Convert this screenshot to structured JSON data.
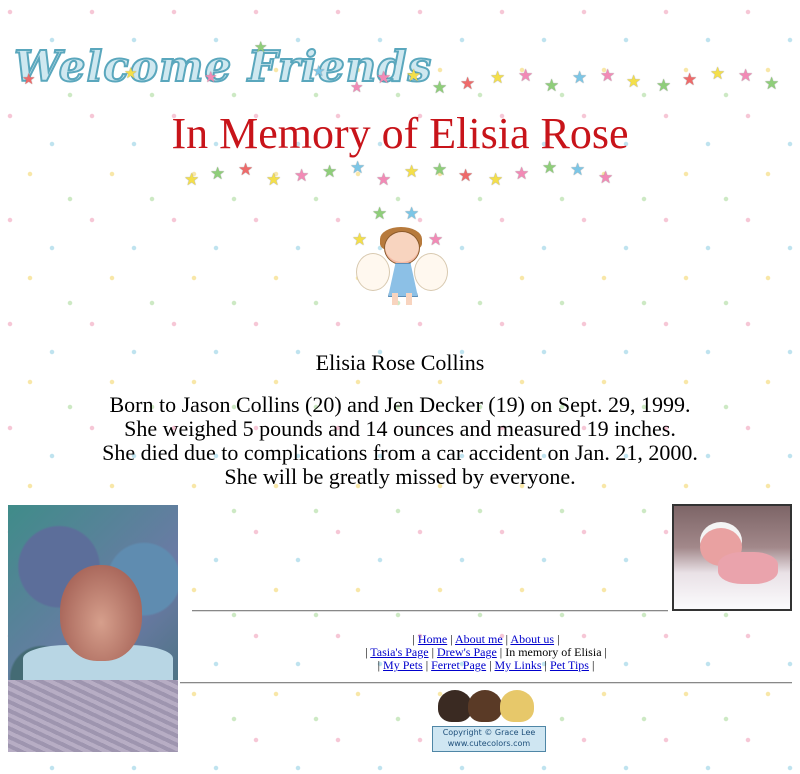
{
  "header": {
    "welcome_text": "Welcome Friends",
    "title": "In Memory of Elisia Rose"
  },
  "colors": {
    "title_red": "#c8141a",
    "link_blue": "#0000cc",
    "star_pink": "#f28ab6",
    "star_yellow": "#f4df4a",
    "star_green": "#8fce7a",
    "star_red": "#ee6a6a",
    "star_blue": "#7cc6e6"
  },
  "content": {
    "name": "Elisia Rose Collins",
    "bio_lines": [
      "Born to Jason Collins (20) and Jen Decker (19) on Sept. 29, 1999.",
      "She weighed 5 pounds and 14 ounces and measured 19 inches.",
      "She died due to complications from a car accident on Jan. 21, 2000.",
      "She will be greatly missed by everyone."
    ]
  },
  "nav": {
    "sep": "|",
    "row1": [
      "Home",
      "About me",
      "About us"
    ],
    "row2_links": [
      "Tasia's Page",
      "Drew's Page"
    ],
    "row2_current": "In memory of Elisia",
    "row3": [
      "My Pets",
      "Ferret Page",
      "My Links",
      "Pet Tips"
    ]
  },
  "footer": {
    "copyright_line1": "Copyright © Grace Lee",
    "copyright_line2": "www.cutecolors.com"
  },
  "icons": [
    "star-icon",
    "angel-icon",
    "baby-photo",
    "copyright-badge"
  ]
}
